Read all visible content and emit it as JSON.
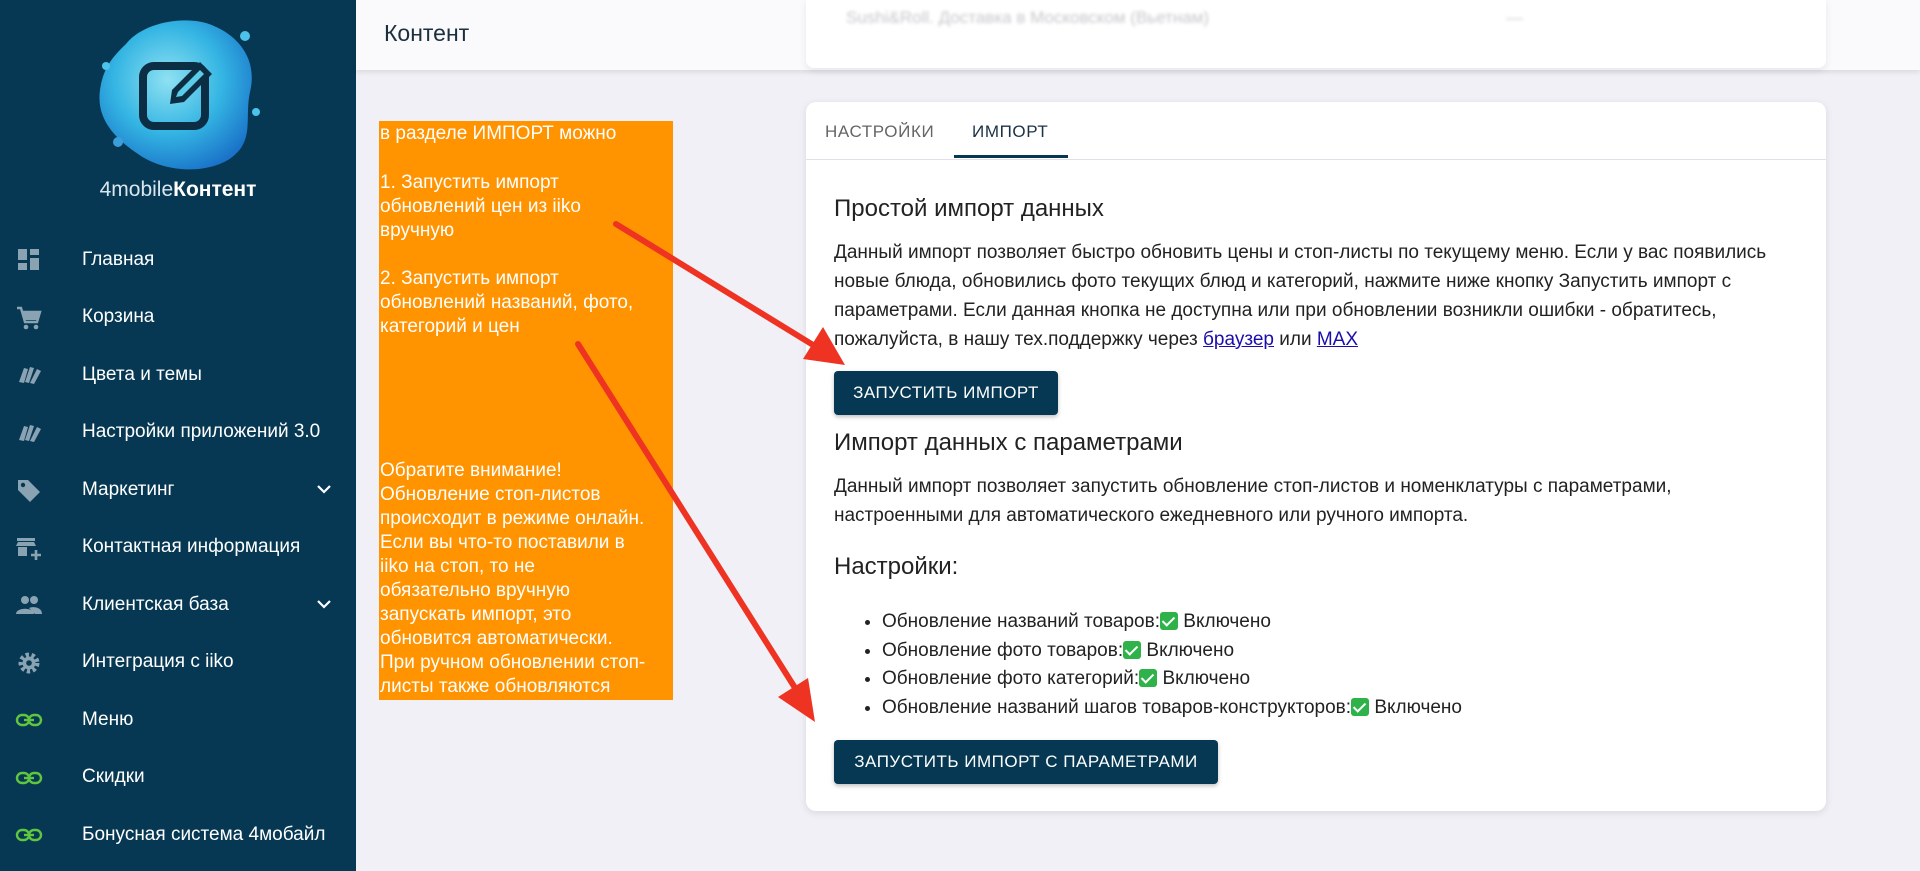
{
  "app": {
    "logo_text_light": "4mobile",
    "logo_text_bold": "Контент",
    "page_title": "Контент"
  },
  "top_card_ghost": {
    "blurred_text": "Sushi&Roll. Доставка в Московском (Вьетнам)",
    "blurred_right": "—"
  },
  "sidebar": {
    "items": [
      {
        "label": "Главная",
        "icon": "dashboard-icon"
      },
      {
        "label": "Корзина",
        "icon": "cart-icon"
      },
      {
        "label": "Цвета и темы",
        "icon": "palette-icon"
      },
      {
        "label": "Настройки приложений 3.0",
        "icon": "palette-icon"
      },
      {
        "label": "Маркетинг",
        "icon": "tag-icon",
        "has_chevron": true
      },
      {
        "label": "Контактная информация",
        "icon": "store-add-icon"
      },
      {
        "label": "Клиентская база",
        "icon": "people-icon",
        "has_chevron": true
      },
      {
        "label": "Интеграция с iiko",
        "icon": "gear-icon"
      },
      {
        "label": "Меню",
        "icon": "link-icon"
      },
      {
        "label": "Скидки",
        "icon": "link-icon"
      },
      {
        "label": "Бонусная система 4мобайл",
        "icon": "link-icon"
      }
    ]
  },
  "note": {
    "p1": "в разделе ИМПОРТ можно",
    "p2": "1. Запустить импорт\nобновлений цен из iiko\nвручную",
    "p3": "2. Запустить импорт\nобновлений названий, фото,\nкатегорий и цен",
    "p4": "Обратите внимание!\nОбновление стоп-листов\nпроисходит в режиме онлайн.\nЕсли вы что-то поставили в\niiko  на стоп, то не\nобязательно вручную\nзапускать импорт, это\nобновится автоматически.\nПри ручном обновлении стоп-\nлисты также обновляются"
  },
  "tabs": [
    {
      "label": "НАСТРОЙКИ",
      "active": false
    },
    {
      "label": "ИМПОРТ",
      "active": true
    }
  ],
  "simple_import": {
    "title": "Простой импорт данных",
    "text_before": "Данный импорт позволяет быстро обновить цены и стоп-листы по текущему меню. Если у вас появились новые блюда, обновились фото текущих блюд и категорий, нажмите ниже кнопку Запустить импорт с параметрами. Если данная кнопка не доступна или при обновлении возникли ошибки - обратитесь, пожалуйста, в нашу тех.поддержку через ",
    "link1": "браузер",
    "text_mid": " или ",
    "link2": "MAX",
    "button": "ЗАПУСТИТЬ ИМПОРТ"
  },
  "param_import": {
    "title": "Импорт данных с параметрами",
    "text": "Данный импорт позволяет запустить обновление стоп-листов и номенклатуры с параметрами, настроенными для автоматического ежедневного или ручного импорта.",
    "settings_title": "Настройки:",
    "settings": [
      {
        "label": "Обновление названий товаров:",
        "status": "Включено"
      },
      {
        "label": "Обновление фото товаров:",
        "status": "Включено"
      },
      {
        "label": "Обновление фото категорий:",
        "status": "Включено"
      },
      {
        "label": "Обновление названий шагов товаров-конструкторов:",
        "status": "Включено"
      }
    ],
    "button": "ЗАПУСТИТЬ ИМПОРТ С ПАРАМЕТРАМИ"
  },
  "colors": {
    "sidebar_bg": "#063853",
    "accent": "#063853",
    "note_bg": "#ff9300",
    "arrow": "#ee3322",
    "check_green": "#2fb24a"
  }
}
